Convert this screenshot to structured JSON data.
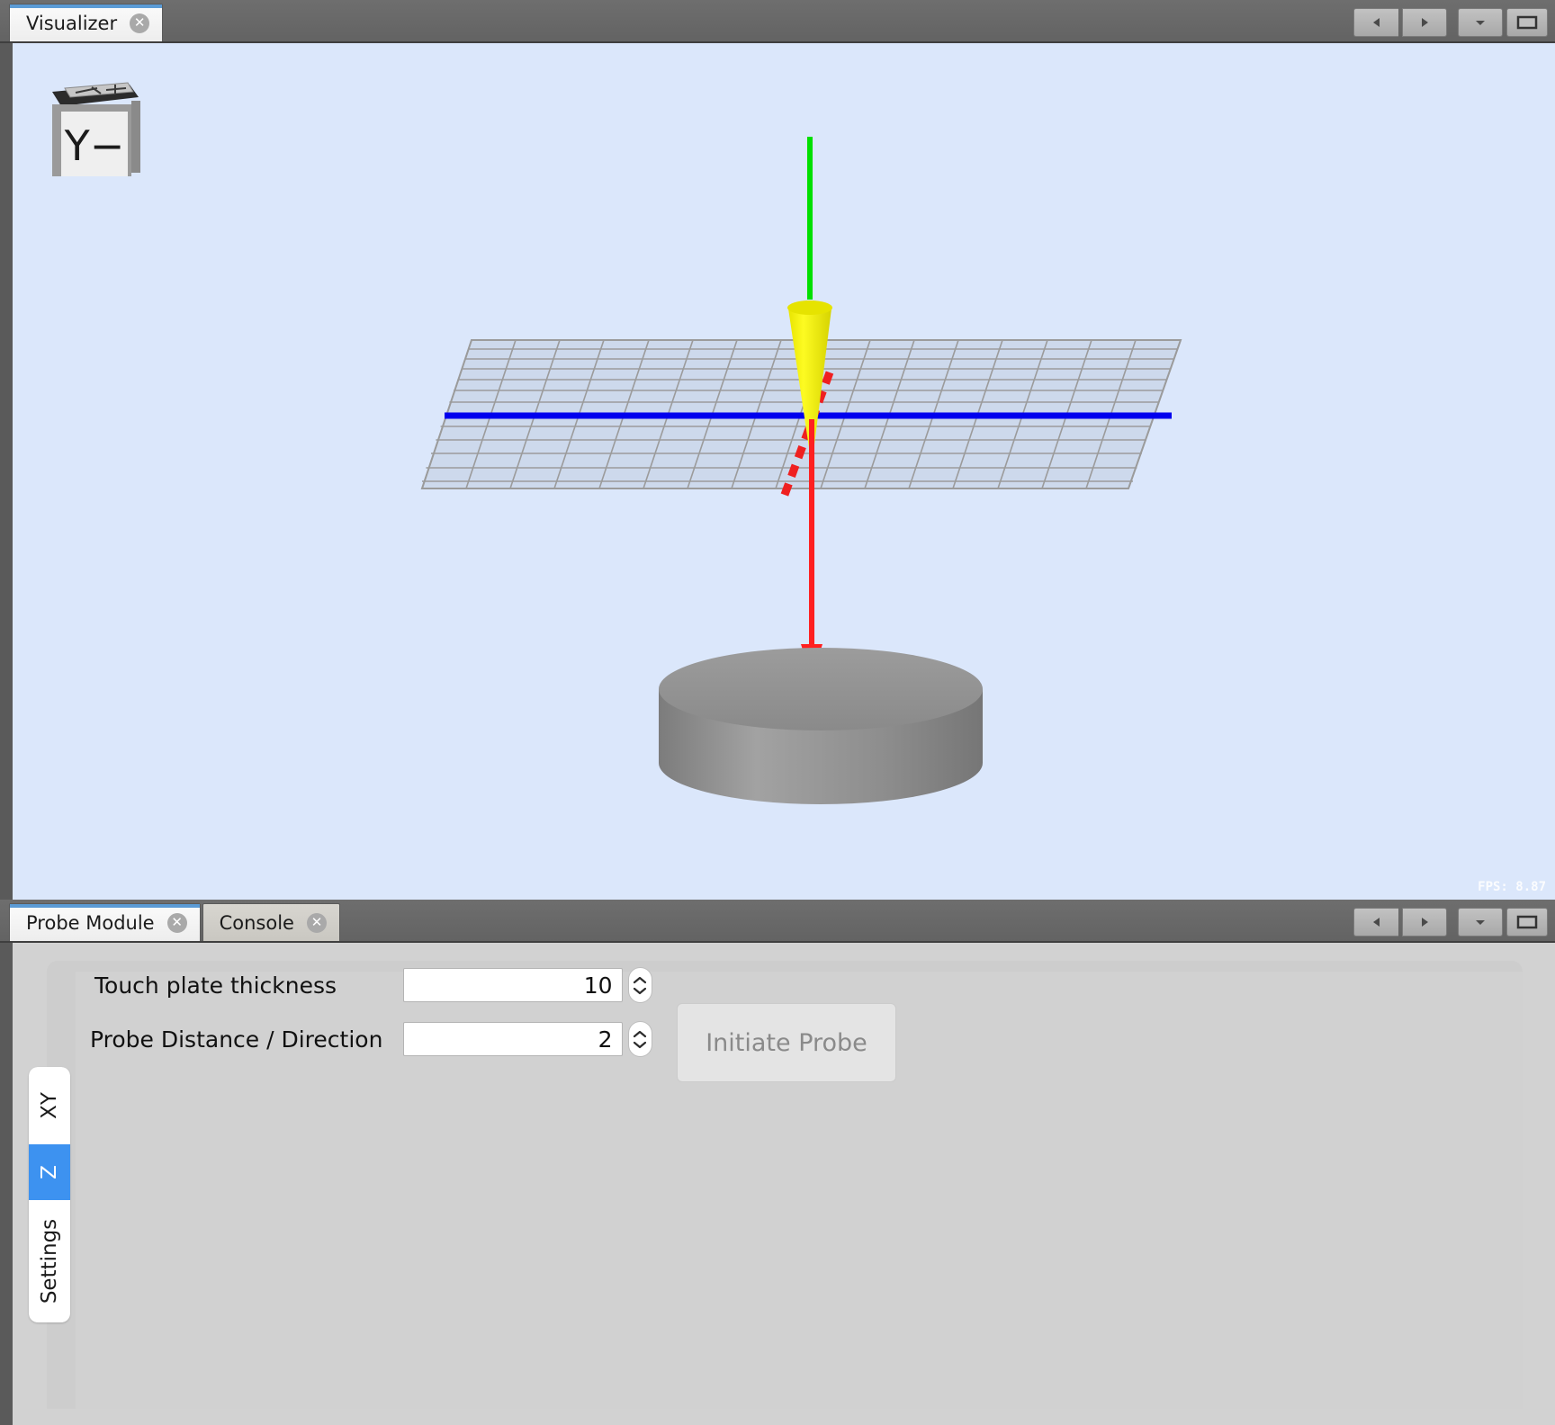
{
  "visualizer": {
    "tab": {
      "label": "Visualizer",
      "close_icon": "close-icon"
    },
    "axis_cube": {
      "label": "Y−"
    },
    "fps": "FPS: 8.87",
    "scene": {
      "grid_plane": "xy-grid-plane",
      "x_axis_color": "#0000ee",
      "z_axis_color": "#00e000",
      "probe_vector_color": "#ff2020",
      "tool_color": "#f2ee12",
      "touch_plate_color": "#8c8c8c",
      "background_color": "#dbe7fb"
    },
    "controls": {
      "prev": "nav-left-icon",
      "next": "nav-right-icon",
      "menu": "chevron-down-icon",
      "maximize": "maximize-icon"
    }
  },
  "probe_panel": {
    "tabs": [
      {
        "label": "Probe Module",
        "active": true
      },
      {
        "label": "Console",
        "active": false
      }
    ],
    "side_tabs": [
      {
        "label": "XY",
        "active": false
      },
      {
        "label": "Z",
        "active": true
      },
      {
        "label": "Settings",
        "active": false
      }
    ],
    "fields": [
      {
        "label": "Touch plate thickness",
        "value": "10"
      },
      {
        "label": "Probe Distance / Direction",
        "value": "2"
      }
    ],
    "initiate_button": {
      "label": "Initiate Probe",
      "enabled": false
    },
    "controls": {
      "prev": "nav-left-icon",
      "next": "nav-right-icon",
      "menu": "chevron-down-icon",
      "maximize": "maximize-icon"
    }
  }
}
